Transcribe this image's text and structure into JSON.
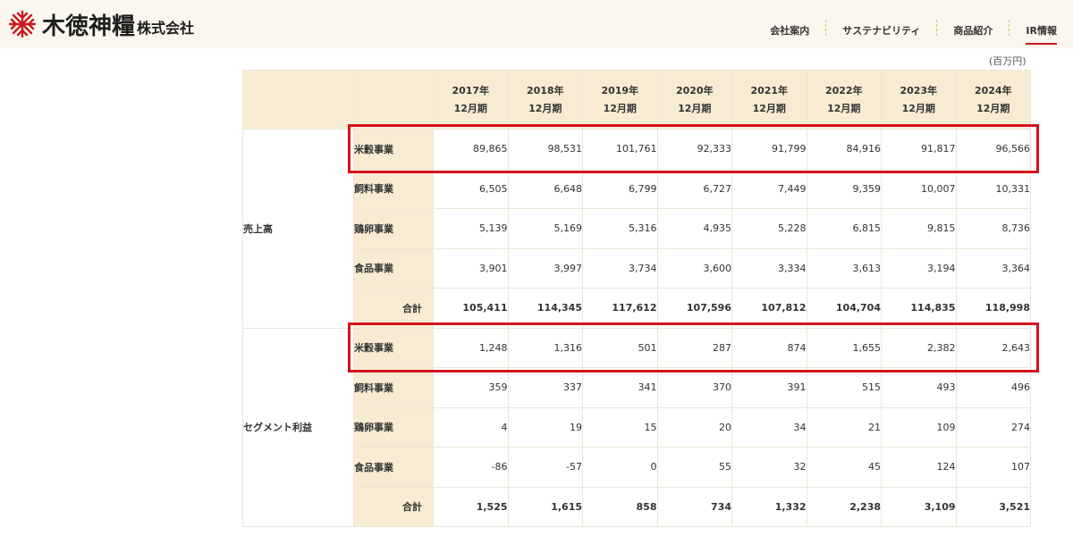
{
  "header": {
    "logo_main": "木徳神糧",
    "logo_sub": "株式会社",
    "nav": [
      {
        "label": "会社案内",
        "active": false
      },
      {
        "label": "サステナビリティ",
        "active": false
      },
      {
        "label": "商品紹介",
        "active": false
      },
      {
        "label": "IR情報",
        "active": true
      }
    ]
  },
  "unit": "(百万円)",
  "table": {
    "periods": [
      {
        "year": "2017年",
        "term": "12月期"
      },
      {
        "year": "2018年",
        "term": "12月期"
      },
      {
        "year": "2019年",
        "term": "12月期"
      },
      {
        "year": "2020年",
        "term": "12月期"
      },
      {
        "year": "2021年",
        "term": "12月期"
      },
      {
        "year": "2022年",
        "term": "12月期"
      },
      {
        "year": "2023年",
        "term": "12月期"
      },
      {
        "year": "2024年",
        "term": "12月期"
      }
    ],
    "sections": [
      {
        "title": "売上高",
        "rows": [
          {
            "label": "米穀事業",
            "values": [
              "89,865",
              "98,531",
              "101,761",
              "92,333",
              "91,799",
              "84,916",
              "91,817",
              "96,566"
            ],
            "highlighted": true
          },
          {
            "label": "飼料事業",
            "values": [
              "6,505",
              "6,648",
              "6,799",
              "6,727",
              "7,449",
              "9,359",
              "10,007",
              "10,331"
            ]
          },
          {
            "label": "鶏卵事業",
            "values": [
              "5,139",
              "5,169",
              "5,316",
              "4,935",
              "5,228",
              "6,815",
              "9,815",
              "8,736"
            ]
          },
          {
            "label": "食品事業",
            "values": [
              "3,901",
              "3,997",
              "3,734",
              "3,600",
              "3,334",
              "3,613",
              "3,194",
              "3,364"
            ]
          },
          {
            "label": "合計",
            "values": [
              "105,411",
              "114,345",
              "117,612",
              "107,596",
              "107,812",
              "104,704",
              "114,835",
              "118,998"
            ],
            "total": true
          }
        ]
      },
      {
        "title": "セグメント利益",
        "rows": [
          {
            "label": "米穀事業",
            "values": [
              "1,248",
              "1,316",
              "501",
              "287",
              "874",
              "1,655",
              "2,382",
              "2,643"
            ],
            "highlighted": true
          },
          {
            "label": "飼料事業",
            "values": [
              "359",
              "337",
              "341",
              "370",
              "391",
              "515",
              "493",
              "496"
            ]
          },
          {
            "label": "鶏卵事業",
            "values": [
              "4",
              "19",
              "15",
              "20",
              "34",
              "21",
              "109",
              "274"
            ]
          },
          {
            "label": "食品事業",
            "values": [
              "-86",
              "-57",
              "0",
              "55",
              "32",
              "45",
              "124",
              "107"
            ]
          },
          {
            "label": "合計",
            "values": [
              "1,525",
              "1,615",
              "858",
              "734",
              "1,332",
              "2,238",
              "3,109",
              "3,521"
            ],
            "total": true
          }
        ]
      }
    ]
  },
  "colors": {
    "accent_red": "#d4141c",
    "header_bg": "#fbf7ee",
    "cell_beige": "#f7ecd3"
  }
}
